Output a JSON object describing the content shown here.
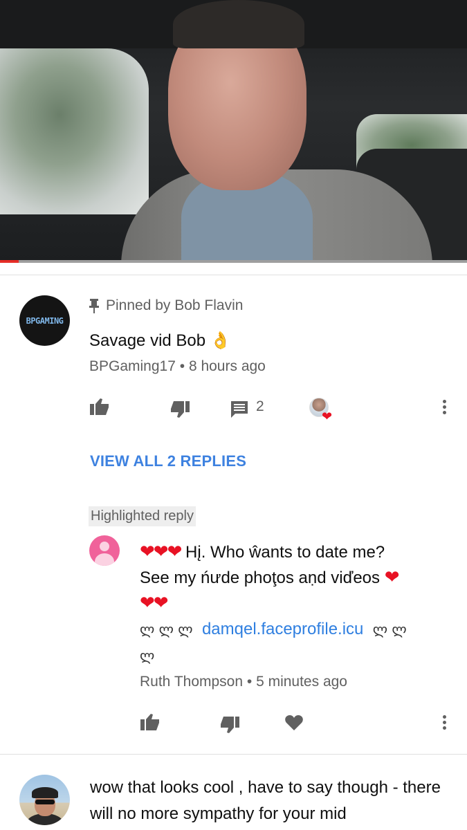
{
  "video": {
    "progress": 0.04
  },
  "pinned_comment": {
    "pinned_label": "Pinned by Bob Flavin",
    "avatar_text": "BPGAMING",
    "text": "Savage vid Bob 👌",
    "author": "BPGaming17",
    "time": "8 hours ago",
    "reply_count": "2",
    "view_replies_label": "VIEW ALL 2 REPLIES"
  },
  "highlighted_reply": {
    "badge_label": "Highlighted reply",
    "line1_hearts": "❤❤❤",
    "line1_text": " Hį. Who ŵants to date me?",
    "line2_text": "See my ńưde phoţos aṇd viďeos ",
    "line2_hearts": " ❤",
    "line3_hearts": "❤❤",
    "glyphs_before": "ლ ლ ლ",
    "link_text": "damqel.faceprofile.icu",
    "glyphs_after": "ლ ლ",
    "glyph_last": "ლ",
    "author": "Ruth Thompson",
    "time": "5 minutes ago"
  },
  "next_comment": {
    "text": "wow that looks cool , have to say though - there will no more sympathy for your mid"
  },
  "colors": {
    "link": "#2f7fe0",
    "heart": "#e81224",
    "progress": "#e52d27",
    "meta": "#606060"
  },
  "icons": [
    "pin-icon",
    "like-icon",
    "dislike-icon",
    "reply-icon",
    "creator-heart-icon",
    "more-icon",
    "heart-icon"
  ]
}
